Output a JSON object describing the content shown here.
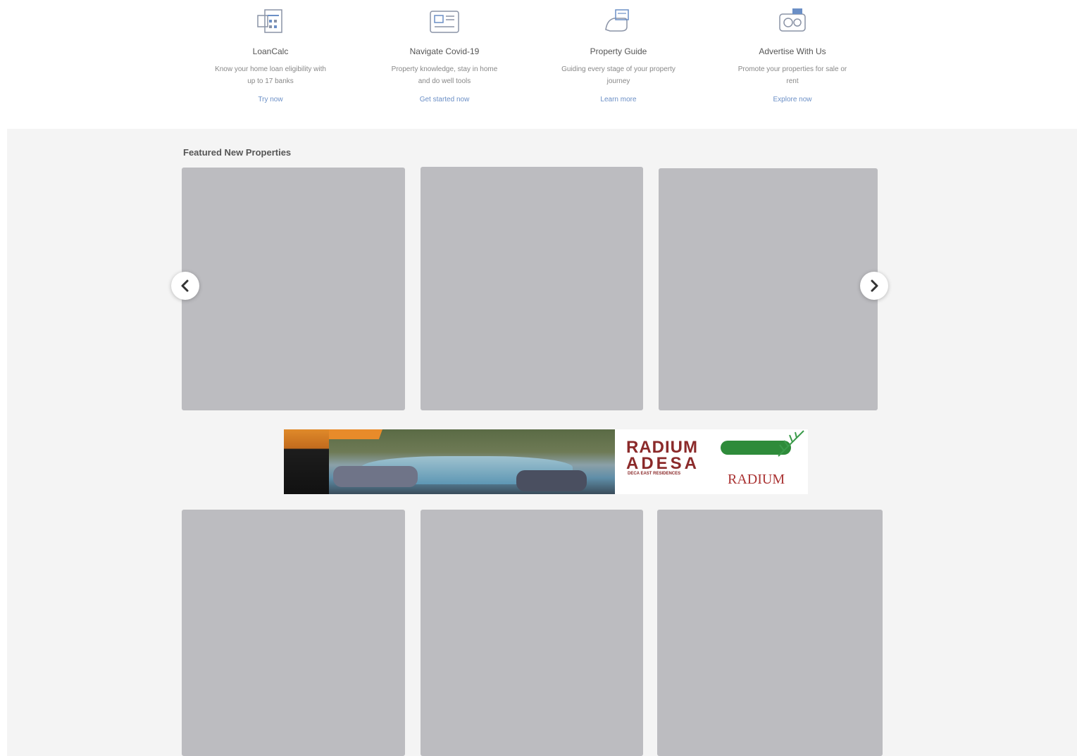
{
  "features": [
    {
      "title": "LoanCalc",
      "desc": "Know your home loan eligibility with up to 17 banks",
      "link": "Try now",
      "icon": "calculator-icon"
    },
    {
      "title": "Navigate Covid-19",
      "desc": "Property knowledge, stay in home and do well tools",
      "link": "Get started now",
      "icon": "newspaper-icon"
    },
    {
      "title": "Property Guide",
      "desc": "Guiding every stage of your property journey",
      "link": "Learn more",
      "icon": "guide-hand-icon"
    },
    {
      "title": "Advertise With Us",
      "desc": "Promote your properties for sale or rent",
      "link": "Explore now",
      "icon": "advertise-icon"
    }
  ],
  "section_title": "Featured New Properties",
  "banner": {
    "name_line1": "RADIUM",
    "name_line2": "ADESA",
    "subtitle": "DECA EAST RESIDENCES",
    "badge_text": "",
    "logo_text": "RADIUM"
  },
  "colors": {
    "card_placeholder": "#bcbcc0",
    "band_bg": "#f4f4f4",
    "link": "#6b8fc6",
    "banner_brand": "#8b2a2a"
  }
}
